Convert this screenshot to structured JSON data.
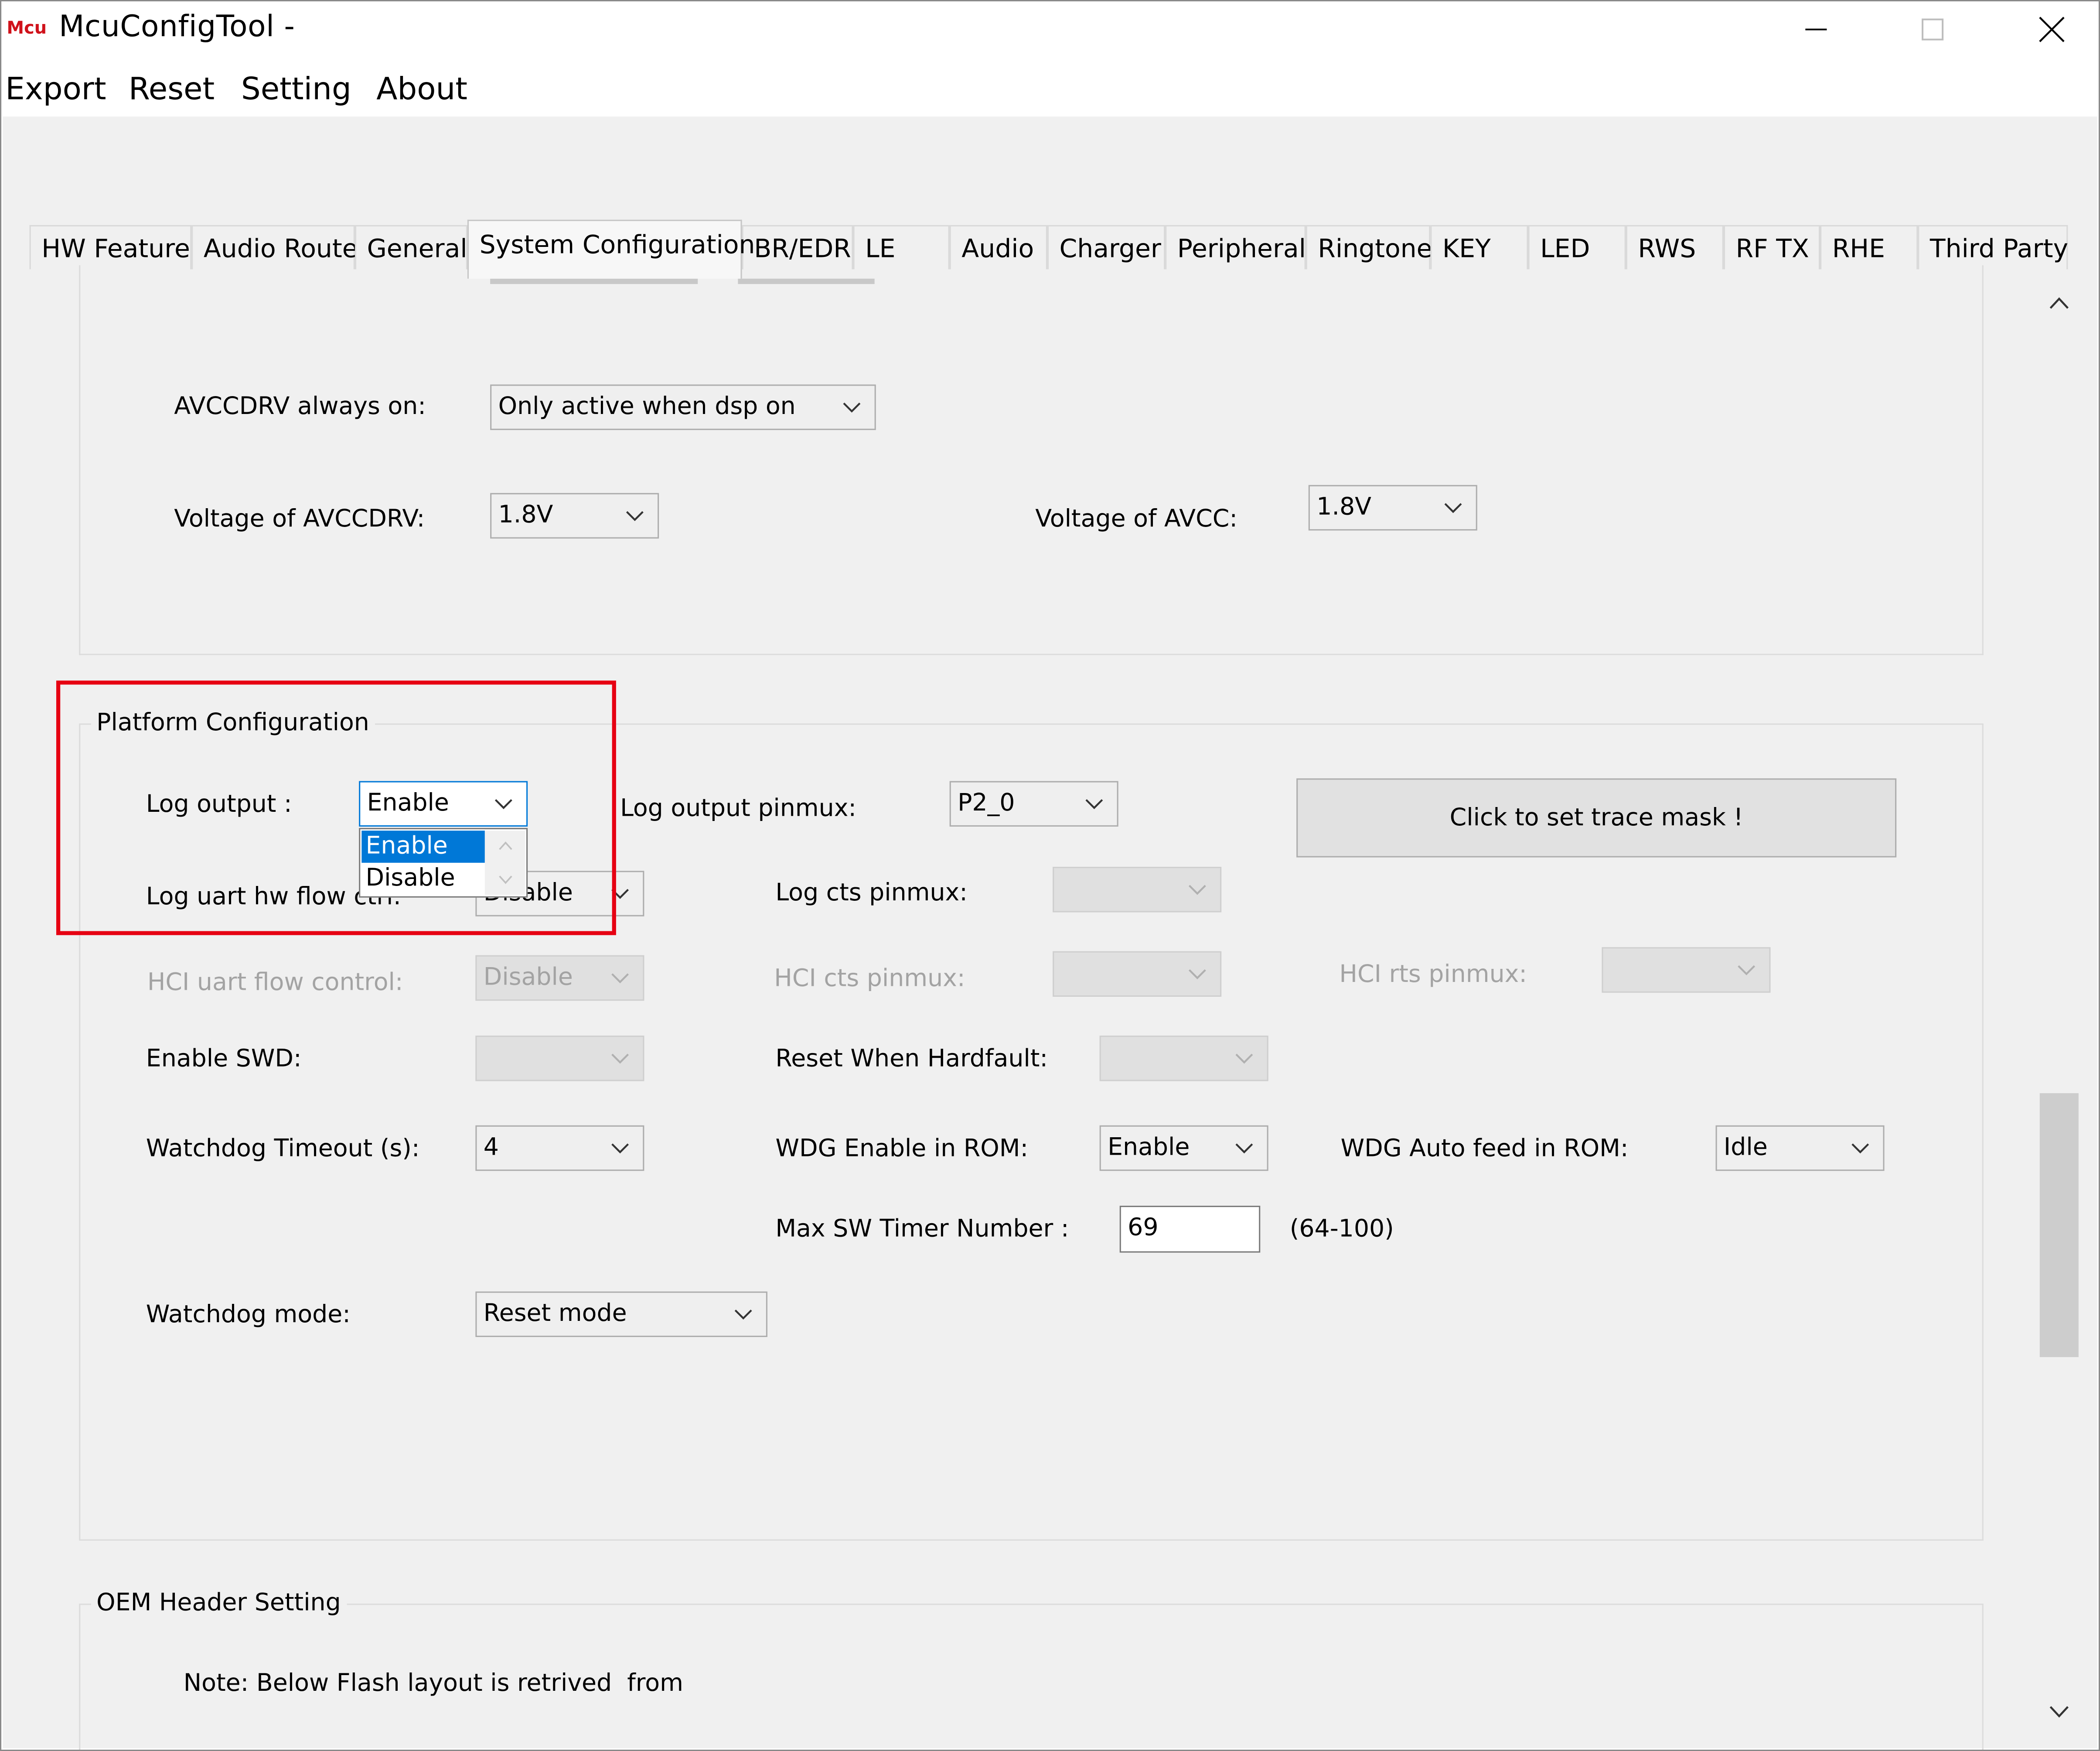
{
  "window": {
    "title": "McuConfigTool -",
    "app_icon_text": "Mcu"
  },
  "menu": [
    "Export",
    "Reset",
    "Setting",
    "About"
  ],
  "tabs": [
    "HW Feature",
    "Audio Route",
    "General",
    "System Configuration",
    "BR/EDR",
    "LE",
    "Audio",
    "Charger",
    "Peripheral",
    "Ringtone",
    "KEY",
    "LED",
    "RWS",
    "RF TX",
    "RHE",
    "Third Party"
  ],
  "active_tab": "System Configuration",
  "power_section": {
    "avccdrv_always_on_label": "AVCCDRV always on:",
    "avccdrv_always_on_value": "Only active when dsp on",
    "voltage_avccdrv_label": "Voltage of AVCCDRV:",
    "voltage_avccdrv_value": "1.8V",
    "voltage_avcc_label": "Voltage of AVCC:",
    "voltage_avcc_value": "1.8V"
  },
  "platform": {
    "title": "Platform Configuration",
    "log_output_label": "Log output :",
    "log_output_value": "Enable",
    "log_output_options": [
      "Enable",
      "Disable"
    ],
    "log_output_pinmux_label": "Log output pinmux:",
    "log_output_pinmux_value": "P2_0",
    "trace_mask_button": "Click to set trace mask !",
    "log_uart_flow_label": "Log uart hw flow ctrl:",
    "log_uart_flow_value": "Disable",
    "log_cts_pinmux_label": "Log cts pinmux:",
    "hci_uart_flow_label": "HCI uart flow control:",
    "hci_uart_flow_value": "Disable",
    "hci_cts_pinmux_label": "HCI cts pinmux:",
    "hci_rts_pinmux_label": "HCI rts pinmux:",
    "enable_swd_label": "Enable SWD:",
    "reset_hardfault_label": "Reset When Hardfault:",
    "watchdog_timeout_label": "Watchdog Timeout (s):",
    "watchdog_timeout_value": "4",
    "wdg_enable_rom_label": "WDG Enable in ROM:",
    "wdg_enable_rom_value": "Enable",
    "wdg_auto_feed_label": "WDG Auto feed in ROM:",
    "wdg_auto_feed_value": "Idle",
    "max_sw_timer_label": "Max SW Timer Number :",
    "max_sw_timer_value": "69",
    "max_sw_timer_range": "(64-100)",
    "watchdog_mode_label": "Watchdog mode:",
    "watchdog_mode_value": "Reset mode"
  },
  "oem": {
    "title": "OEM Header Setting",
    "note": "Note: Below Flash layout is retrived  from"
  },
  "colors": {
    "highlight_box": "#e60012",
    "selection": "#0078d7",
    "panel_bg": "#f0f0f0"
  }
}
